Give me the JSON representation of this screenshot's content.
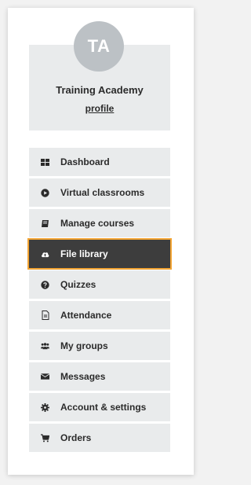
{
  "profile": {
    "avatar_initials": "TA",
    "org_name": "Training Academy",
    "link_label": "profile"
  },
  "colors": {
    "accent": "#f3a433",
    "active_bg": "#3d3d3d",
    "item_bg": "#e9ebec",
    "avatar_bg": "#bcc1c5"
  },
  "menu": {
    "items": [
      {
        "label": "Dashboard",
        "icon": "grid-icon",
        "active": false
      },
      {
        "label": "Virtual classrooms",
        "icon": "play-circle-icon",
        "active": false
      },
      {
        "label": "Manage courses",
        "icon": "book-icon",
        "active": false
      },
      {
        "label": "File library",
        "icon": "cloud-upload-icon",
        "active": true
      },
      {
        "label": "Quizzes",
        "icon": "question-circle-icon",
        "active": false
      },
      {
        "label": "Attendance",
        "icon": "document-icon",
        "active": false
      },
      {
        "label": "My groups",
        "icon": "users-icon",
        "active": false
      },
      {
        "label": "Messages",
        "icon": "envelope-icon",
        "active": false
      },
      {
        "label": "Account & settings",
        "icon": "gear-icon",
        "active": false
      },
      {
        "label": "Orders",
        "icon": "cart-icon",
        "active": false
      }
    ]
  }
}
